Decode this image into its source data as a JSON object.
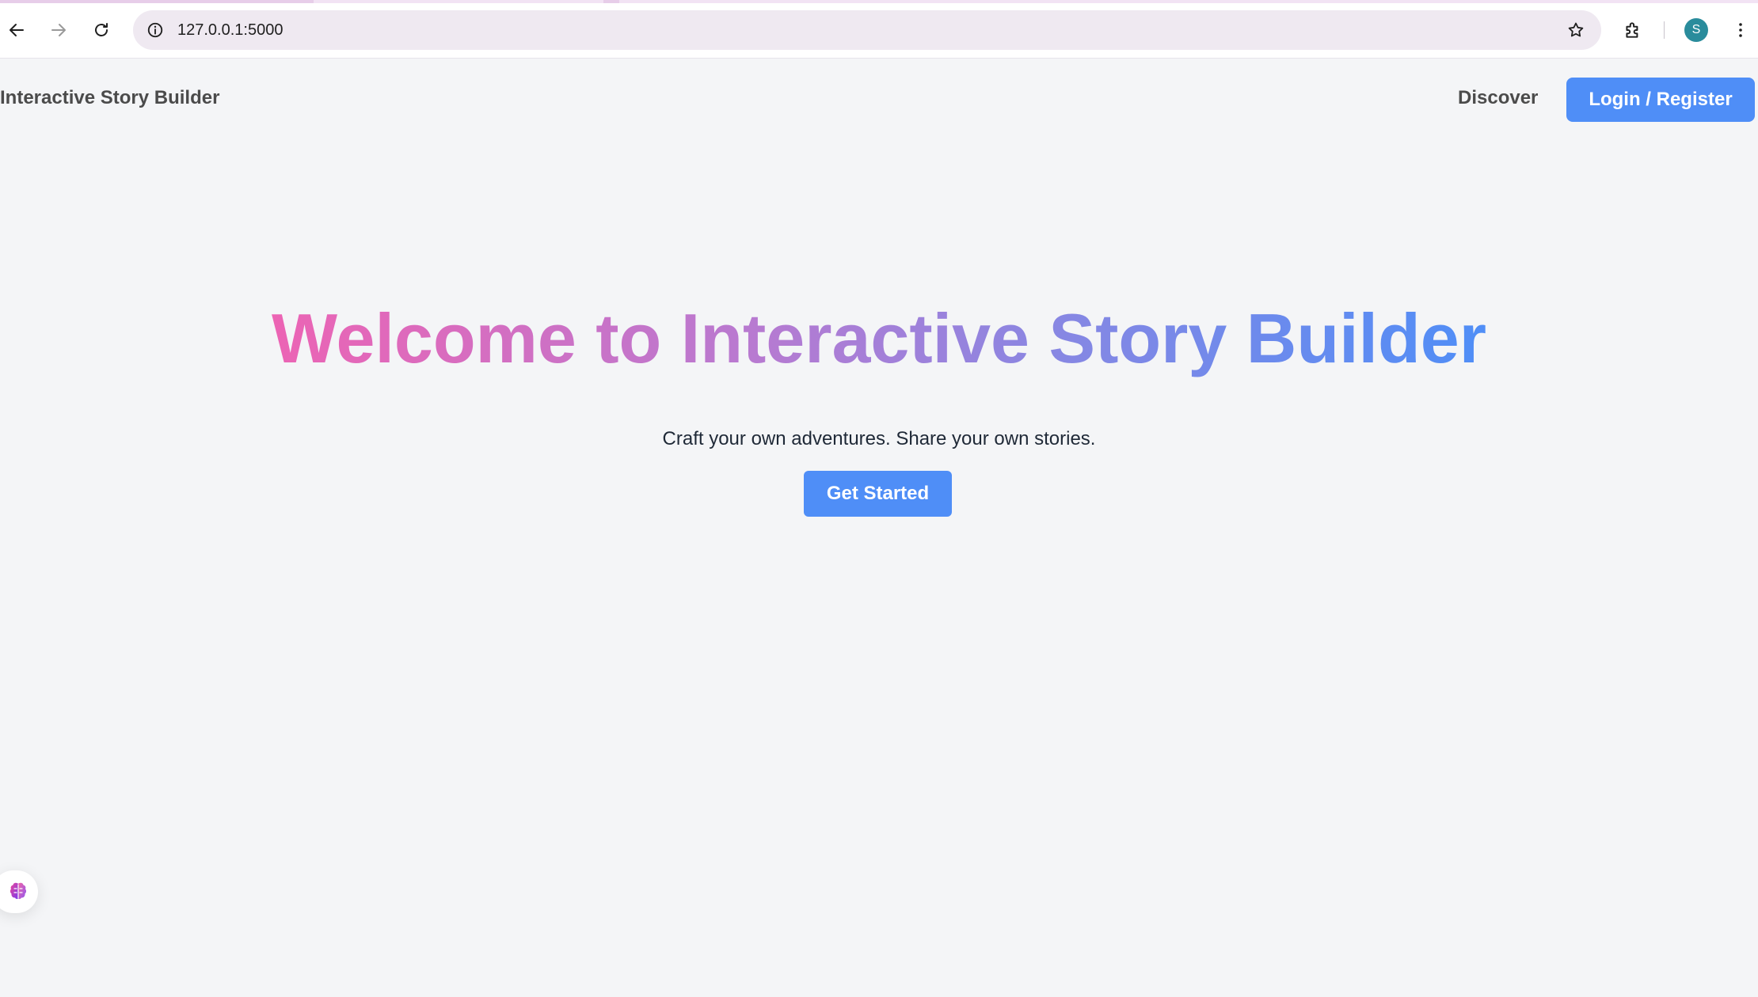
{
  "browser": {
    "url": "127.0.0.1:5000",
    "profile_initial": "S",
    "profile_color": "#2a8c9c",
    "icons": {
      "back": "arrow-left-icon",
      "forward": "arrow-right-icon",
      "reload": "reload-icon",
      "site_info": "info-circle-icon",
      "bookmark": "star-icon",
      "extensions": "puzzle-icon",
      "menu": "kebab-menu-icon"
    }
  },
  "header": {
    "brand": "Interactive Story Builder",
    "nav_discover": "Discover",
    "login_label": "Login / Register"
  },
  "hero": {
    "title": "Welcome to Interactive Story Builder",
    "subtitle": "Craft your own adventures. Share your own stories.",
    "cta_label": "Get Started"
  },
  "floating_widget": {
    "icon": "brain-icon"
  },
  "colors": {
    "accent": "#4f8ef7",
    "title_gradient_start": "#ec64b4",
    "title_gradient_end": "#4f8ef7",
    "page_background": "#f4f5f7",
    "nav_text": "#4b4b4b"
  }
}
